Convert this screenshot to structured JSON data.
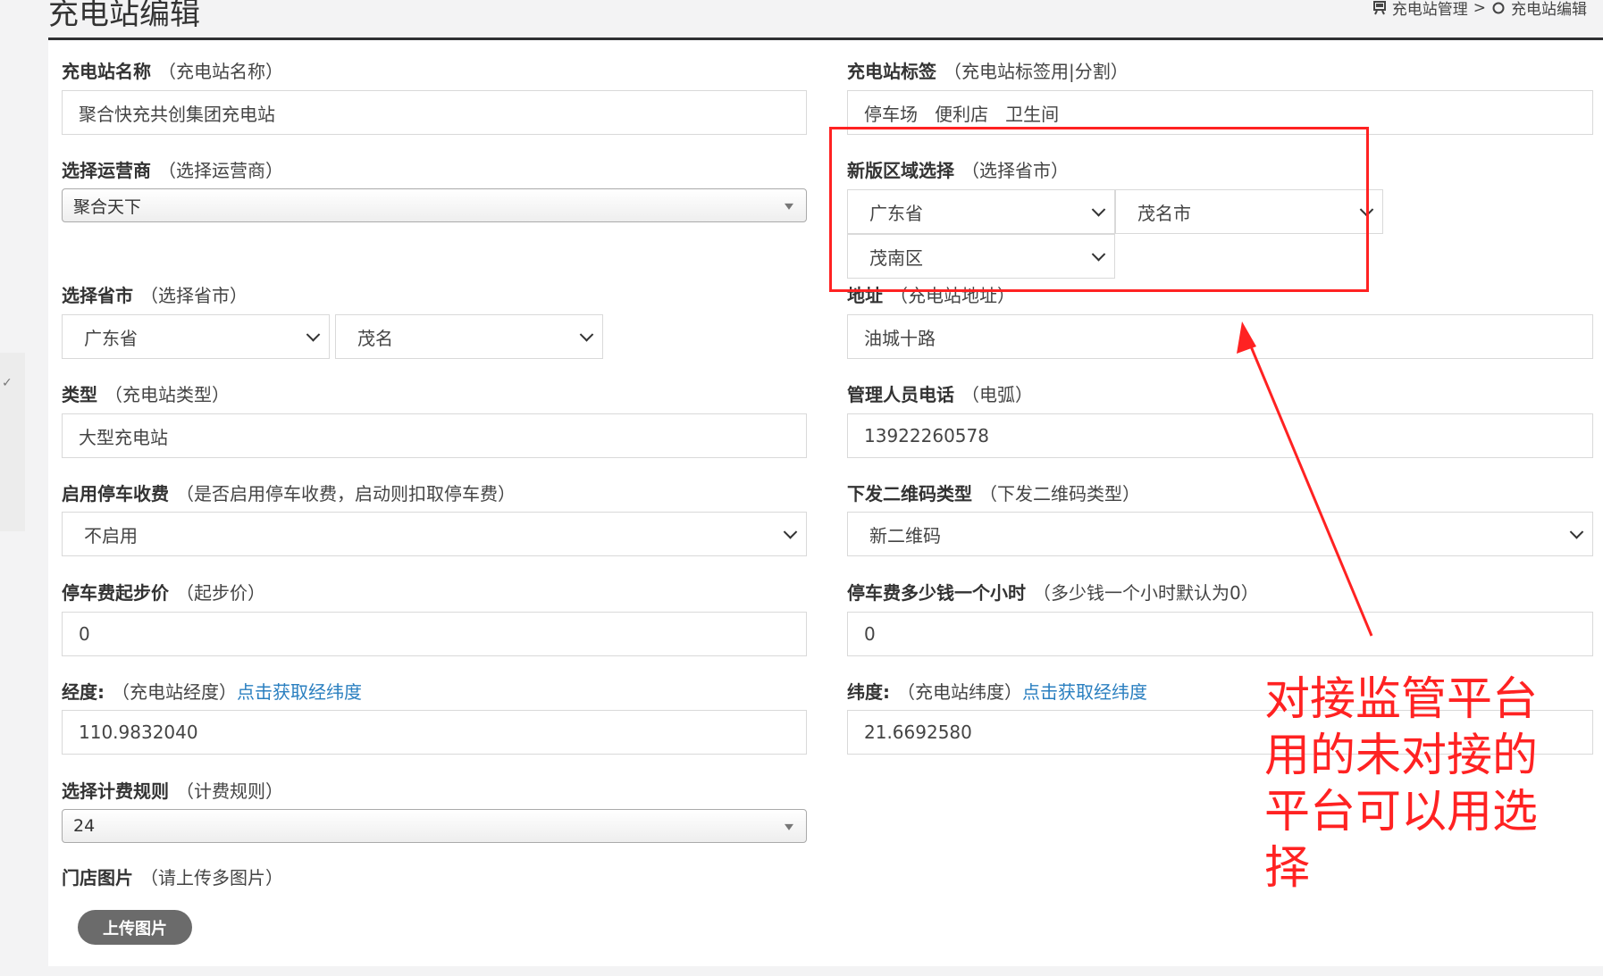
{
  "header": {
    "title": "充电站编辑",
    "breadcrumb": {
      "parent": "充电站管理",
      "separator": ">",
      "current": "充电站编辑"
    }
  },
  "sidebar": {
    "collapse_glyph": "✓"
  },
  "form": {
    "name": {
      "label": "充电站名称",
      "hint": "（充电站名称）",
      "value": "聚合快充共创集团充电站"
    },
    "tags": {
      "label": "充电站标签",
      "hint": "（充电站标签用|分割）",
      "value": "停车场   便利店   卫生间"
    },
    "operator": {
      "label": "选择运营商",
      "hint": "（选择运营商）",
      "value": "聚合天下"
    },
    "new_region": {
      "label": "新版区域选择",
      "hint": "（选择省市）",
      "province": "广东省",
      "city": "茂名市",
      "district": "茂南区"
    },
    "province_city": {
      "label": "选择省市",
      "hint": "（选择省市）",
      "province": "广东省",
      "city": "茂名"
    },
    "address": {
      "label": "地址",
      "hint": "（充电站地址）",
      "value": "油城十路"
    },
    "type": {
      "label": "类型",
      "hint": "（充电站类型）",
      "value": "大型充电站"
    },
    "phone": {
      "label": "管理人员电话",
      "hint": "（电弧）",
      "value": "13922260578"
    },
    "parking_fee": {
      "label": "启用停车收费",
      "hint": "（是否启用停车收费，启动则扣取停车费）",
      "value": "不启用"
    },
    "qr_type": {
      "label": "下发二维码类型",
      "hint": "（下发二维码类型）",
      "value": "新二维码"
    },
    "start_price": {
      "label": "停车费起步价",
      "hint": "（起步价）",
      "value": "0"
    },
    "hourly_fee": {
      "label": "停车费多少钱一个小时",
      "hint": "（多少钱一个小时默认为0）",
      "value": "0"
    },
    "longitude": {
      "label": "经度:",
      "hint": "（充电站经度）",
      "link": "点击获取经纬度",
      "value": "110.9832040"
    },
    "latitude": {
      "label": "纬度:",
      "hint": "（充电站纬度）",
      "link": "点击获取经纬度",
      "value": "21.6692580"
    },
    "billing": {
      "label": "选择计费规则",
      "hint": "（计费规则）",
      "value": "24"
    },
    "images": {
      "label": "门店图片",
      "hint": "（请上传多图片）",
      "button": "上传图片"
    }
  },
  "annotation": {
    "text": "对接监管平台用的未对接的平台可以用选择",
    "color": "#ff2222"
  }
}
